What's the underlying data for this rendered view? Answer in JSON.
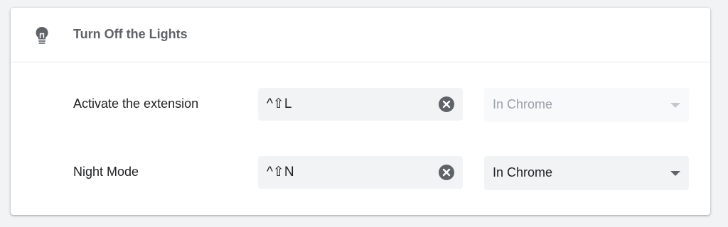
{
  "extension": {
    "name": "Turn Off the Lights",
    "icon": "lightbulb-icon"
  },
  "shortcuts": [
    {
      "label": "Activate the extension",
      "shortcut": "^⇧L",
      "scope": "In Chrome",
      "scope_disabled": true,
      "clear_icon": "close-circle-icon"
    },
    {
      "label": "Night Mode",
      "shortcut": "^⇧N",
      "scope": "In Chrome",
      "scope_disabled": false,
      "clear_icon": "close-circle-icon"
    }
  ],
  "colors": {
    "title": "#5f6368",
    "field_bg": "#f1f3f4",
    "disabled_text": "#9aa0a6",
    "clear_icon": "#5f6368"
  }
}
